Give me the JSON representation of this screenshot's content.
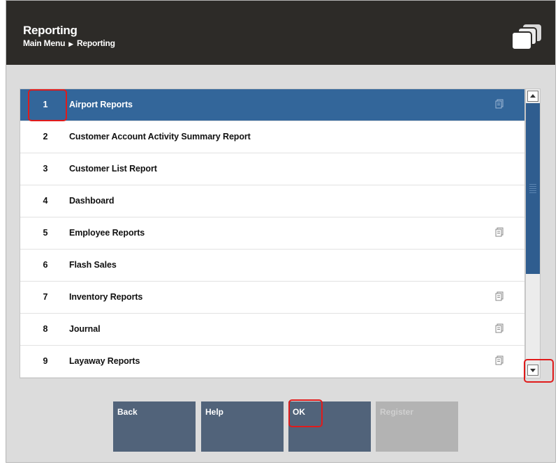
{
  "header": {
    "title": "Reporting",
    "breadcrumb": {
      "parent": "Main Menu",
      "separator": "▶",
      "current": "Reporting"
    },
    "icon": "windows-icon"
  },
  "menu": {
    "items": [
      {
        "num": "1",
        "label": "Airport Reports",
        "submenu": true,
        "selected": true
      },
      {
        "num": "2",
        "label": "Customer Account Activity Summary Report",
        "submenu": false
      },
      {
        "num": "3",
        "label": "Customer List Report",
        "submenu": false
      },
      {
        "num": "4",
        "label": "Dashboard",
        "submenu": false
      },
      {
        "num": "5",
        "label": "Employee Reports",
        "submenu": true
      },
      {
        "num": "6",
        "label": "Flash Sales",
        "submenu": false
      },
      {
        "num": "7",
        "label": "Inventory Reports",
        "submenu": true
      },
      {
        "num": "8",
        "label": "Journal",
        "submenu": true
      },
      {
        "num": "9",
        "label": "Layaway Reports",
        "submenu": true
      }
    ]
  },
  "buttons": {
    "back": "Back",
    "help": "Help",
    "ok": "OK",
    "register": "Register"
  },
  "colors": {
    "header_bg": "#2d2b28",
    "selection": "#33669a",
    "button": "#51637a",
    "highlight": "#e01b1b"
  }
}
